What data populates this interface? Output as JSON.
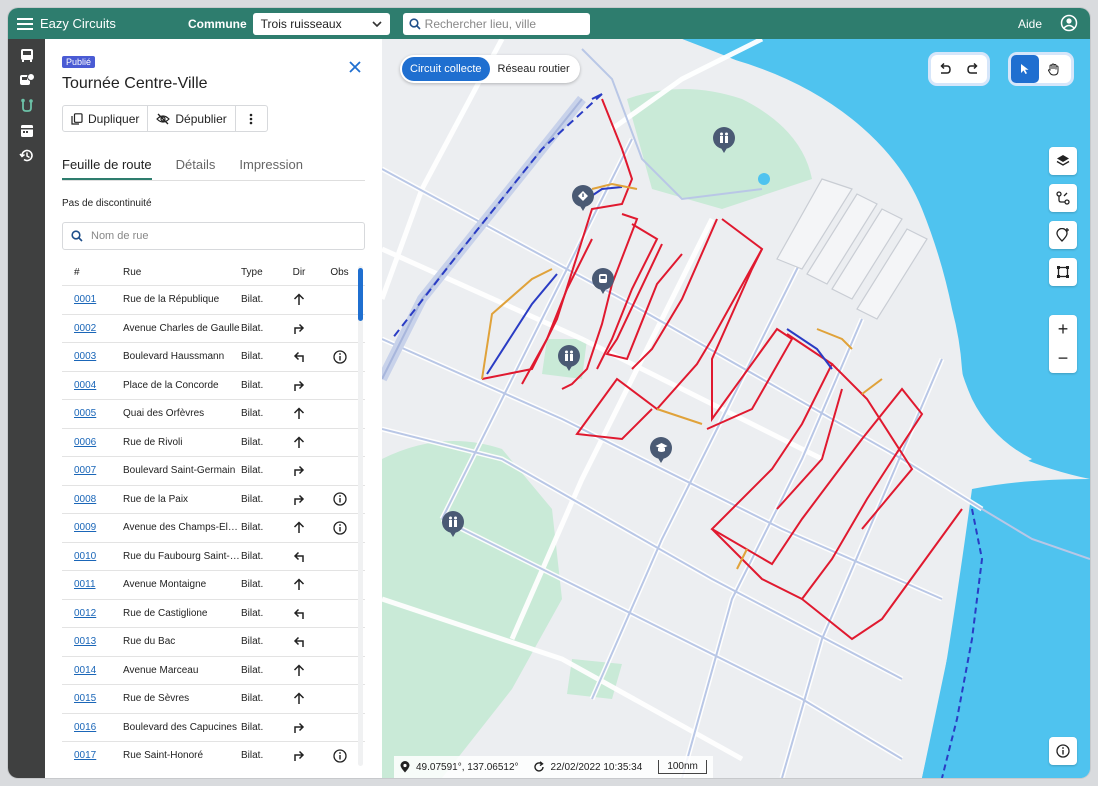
{
  "header": {
    "app_title": "Eazy Circuits",
    "commune_label": "Commune",
    "commune_value": "Trois ruisseaux",
    "search_placeholder": "Rechercher lieu, ville",
    "help_label": "Aide"
  },
  "rail": {
    "items": [
      "bus-icon",
      "bus-schedule-icon",
      "route-icon",
      "calendar-icon",
      "history-icon"
    ],
    "active_index": 2
  },
  "panel": {
    "status_badge": "Publié",
    "title": "Tournée Centre-Ville",
    "actions": {
      "duplicate": "Dupliquer",
      "unpublish": "Dépublier"
    },
    "tabs": [
      "Feuille de route",
      "Détails",
      "Impression"
    ],
    "active_tab": 0,
    "discontinuity_label": "Pas de discontinuité",
    "street_filter_placeholder": "Nom de rue",
    "table": {
      "columns": [
        "#",
        "Rue",
        "Type",
        "Dir",
        "Obs"
      ],
      "rows": [
        {
          "num": "0001",
          "rue": "Rue de la République",
          "type": "Bilat.",
          "dir": "up",
          "obs": false
        },
        {
          "num": "0002",
          "rue": "Avenue Charles de Gaulle",
          "type": "Bilat.",
          "dir": "right",
          "obs": false
        },
        {
          "num": "0003",
          "rue": "Boulevard Haussmann",
          "type": "Bilat.",
          "dir": "left",
          "obs": true
        },
        {
          "num": "0004",
          "rue": "Place de la Concorde",
          "type": "Bilat.",
          "dir": "right",
          "obs": false
        },
        {
          "num": "0005",
          "rue": "Quai des Orfèvres",
          "type": "Bilat.",
          "dir": "up",
          "obs": false
        },
        {
          "num": "0006",
          "rue": "Rue de Rivoli",
          "type": "Bilat.",
          "dir": "up",
          "obs": false
        },
        {
          "num": "0007",
          "rue": "Boulevard Saint-Germain",
          "type": "Bilat.",
          "dir": "right",
          "obs": false
        },
        {
          "num": "0008",
          "rue": "Rue de la Paix",
          "type": "Bilat.",
          "dir": "right",
          "obs": true
        },
        {
          "num": "0009",
          "rue": "Avenue des Champs-Élysées",
          "type": "Bilat.",
          "dir": "up",
          "obs": true
        },
        {
          "num": "0010",
          "rue": "Rue du Faubourg Saint-Honoré",
          "type": "Bilat.",
          "dir": "left",
          "obs": false
        },
        {
          "num": "0011",
          "rue": "Avenue Montaigne",
          "type": "Bilat.",
          "dir": "up",
          "obs": false
        },
        {
          "num": "0012",
          "rue": "Rue de Castiglione",
          "type": "Bilat.",
          "dir": "left",
          "obs": false
        },
        {
          "num": "0013",
          "rue": "Rue du Bac",
          "type": "Bilat.",
          "dir": "left",
          "obs": false
        },
        {
          "num": "0014",
          "rue": "Avenue Marceau",
          "type": "Bilat.",
          "dir": "up",
          "obs": false
        },
        {
          "num": "0015",
          "rue": "Rue de Sèvres",
          "type": "Bilat.",
          "dir": "up",
          "obs": false
        },
        {
          "num": "0016",
          "rue": "Boulevard des Capucines",
          "type": "Bilat.",
          "dir": "right",
          "obs": false
        },
        {
          "num": "0017",
          "rue": "Rue Saint-Honoré",
          "type": "Bilat.",
          "dir": "right",
          "obs": true
        }
      ]
    }
  },
  "map": {
    "layer_toggle": {
      "options": [
        "Circuit collecte",
        "Réseau routier"
      ],
      "active_index": 0
    },
    "status": {
      "coordinates": "49.07591°, 137.06512°",
      "timestamp": "22/02/2022 10:35:34",
      "scale": "100nm"
    },
    "zoom_in": "+",
    "zoom_out": "−",
    "colors": {
      "route_red": "#e0192f",
      "route_blue": "#2a3cc4",
      "route_orange": "#e0a23a",
      "water": "#4fc3ef",
      "park": "#c9ead7",
      "accent": "#1f6fd0",
      "brand": "#2e7d6e"
    }
  }
}
